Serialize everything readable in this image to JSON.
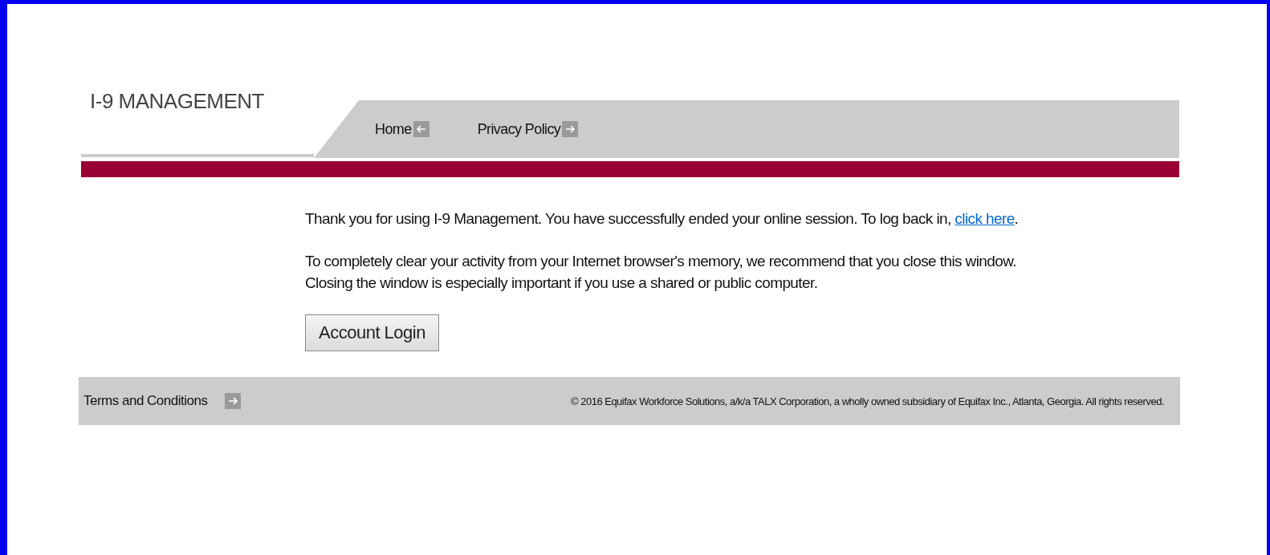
{
  "header": {
    "title": "I-9 MANAGEMENT"
  },
  "nav": [
    {
      "label": "Home"
    },
    {
      "label": "Privacy Policy"
    }
  ],
  "message": {
    "paragraphs": [
      "Thank you for using I-9 Management.  You have successfully ended your online session.  To log back in, ",
      "To completely clear your activity from your Internet browser's memory, we recommend that you close this window.  Closing the window is especially important if you use a shared or public computer."
    ],
    "link": "click here",
    "link_tail": "."
  },
  "button": "Account Login",
  "footer": {
    "link": "Terms and Conditions",
    "copyright": "© 2016 Equifax Workforce Solutions, a/k/a TALX Corporation, a wholly owned subsidiary of Equifax Inc., Atlanta, Georgia. All rights reserved."
  }
}
